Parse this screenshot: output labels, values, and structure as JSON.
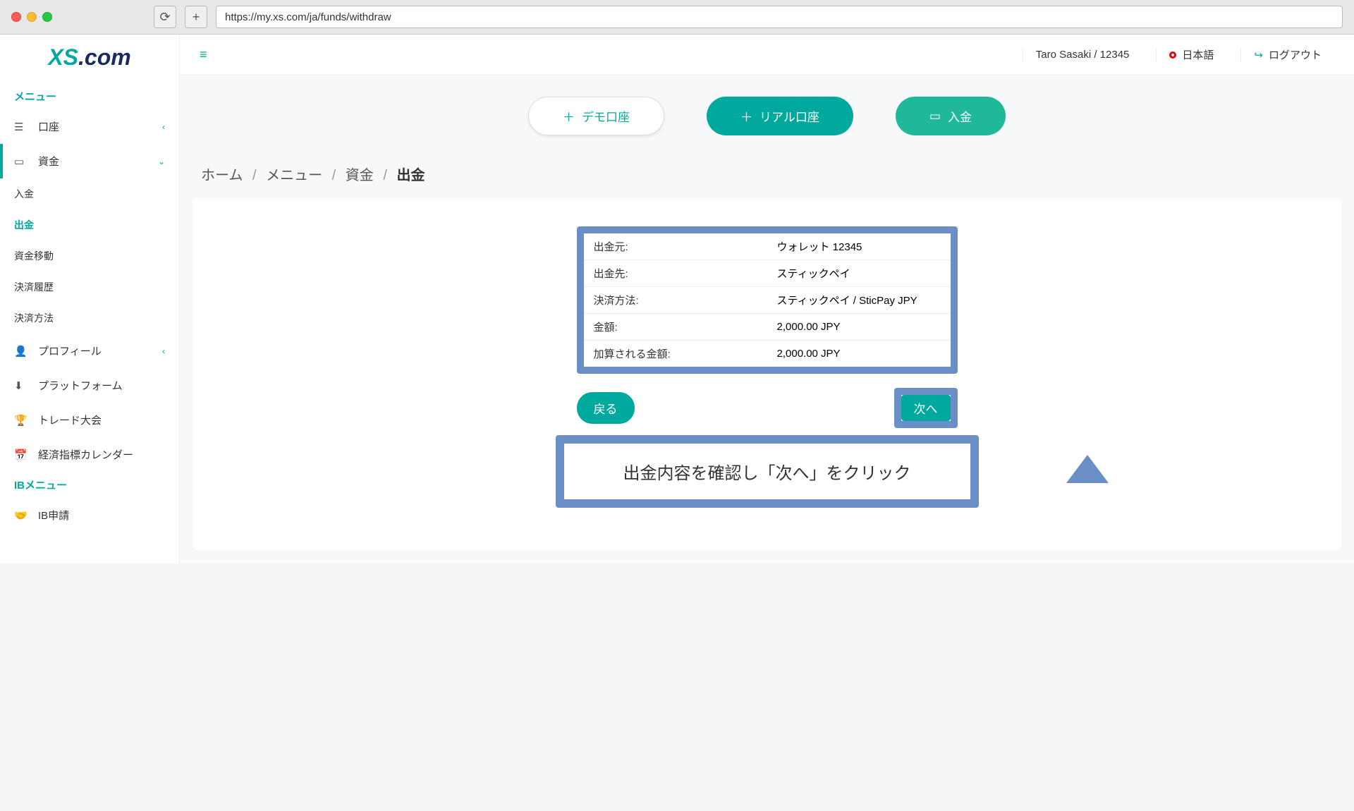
{
  "browser": {
    "url": "https://my.xs.com/ja/funds/withdraw"
  },
  "logo": {
    "xs": "XS",
    "com": ".com"
  },
  "sidebar": {
    "menu_header": "メニュー",
    "account": "口座",
    "funds": "資金",
    "deposit": "入金",
    "withdraw": "出金",
    "transfer": "資金移動",
    "history": "決済履歴",
    "methods": "決済方法",
    "profile": "プロフィール",
    "platform": "プラットフォーム",
    "contest": "トレード大会",
    "calendar": "経済指標カレンダー",
    "ib_header": "IBメニュー",
    "ib_apply": "IB申請"
  },
  "topbar": {
    "user": "Taro Sasaki / 12345",
    "language": "日本語",
    "logout": "ログアウト"
  },
  "actions": {
    "demo": "デモ口座",
    "real": "リアル口座",
    "deposit": "入金"
  },
  "breadcrumb": {
    "home": "ホーム",
    "menu": "メニュー",
    "funds": "資金",
    "current": "出金"
  },
  "details": {
    "from_label": "出金元:",
    "from_value": "ウォレット 12345",
    "to_label": "出金先:",
    "to_value": "スティックペイ",
    "method_label": "決済方法:",
    "method_value": "スティックペイ / SticPay JPY",
    "amount_label": "金額:",
    "amount_value": "2,000.00 JPY",
    "credited_label": "加算される金額:",
    "credited_value": "2,000.00 JPY"
  },
  "buttons": {
    "back": "戻る",
    "next": "次へ"
  },
  "callout": "出金内容を確認し「次へ」をクリック"
}
